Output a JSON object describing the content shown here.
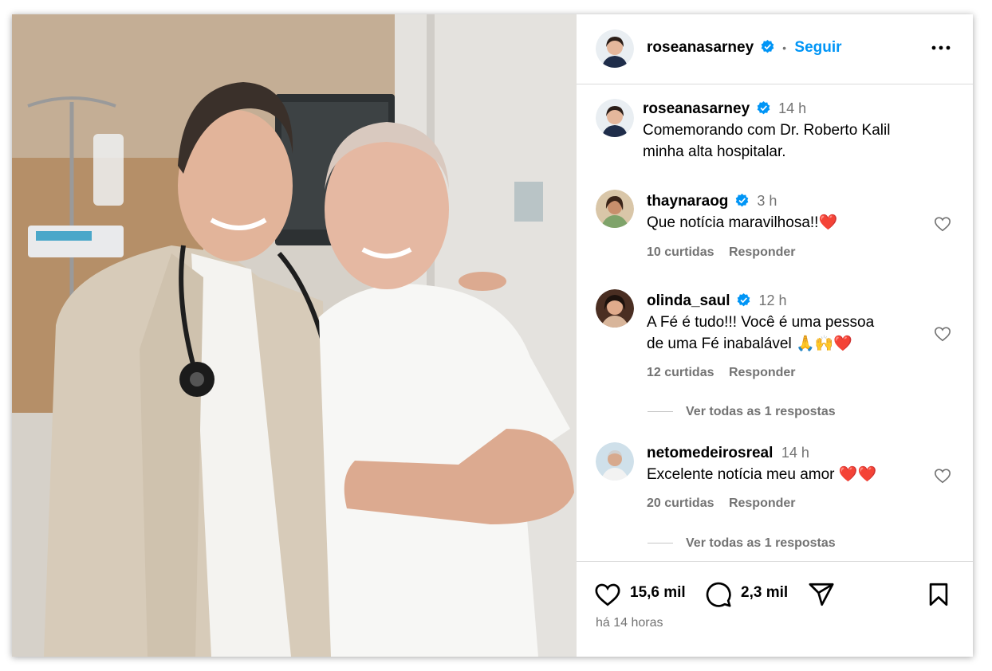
{
  "post": {
    "author": "roseanasarney",
    "follow_label": "Seguir",
    "separator": "•",
    "more_icon": "more-icon",
    "caption_time": "14 h",
    "caption_line1": "Comemorando com Dr. Roberto Kalil",
    "caption_line2": "minha alta hospitalar.",
    "likes": "15,6 mil",
    "comments_count": "2,3 mil",
    "posted_ago": "há 14 horas"
  },
  "comments": [
    {
      "user": "thaynaraog",
      "time": "3 h",
      "verified": true,
      "text_line1": "Que notícia maravilhosa!!❤️",
      "text_line2": "",
      "likes": "10 curtidas",
      "reply": "Responder"
    },
    {
      "user": "olinda_saul",
      "time": "12 h",
      "verified": true,
      "text_line1": "A Fé é tudo!!! Você é uma pessoa",
      "text_line2": "de uma Fé inabalável 🙏🙌❤️",
      "likes": "12 curtidas",
      "reply": "Responder",
      "view_replies": "Ver todas as 1 respostas"
    },
    {
      "user": "netomedeirosreal",
      "time": "14 h",
      "verified": false,
      "text_line1": "Excelente notícia meu amor ❤️❤️",
      "text_line2": "",
      "likes": "20 curtidas",
      "reply": "Responder",
      "view_replies": "Ver todas as 1 respostas"
    }
  ],
  "colors": {
    "link": "#0095f6",
    "verified": "#0095f6",
    "muted": "#737373",
    "divider": "#dbdbdb"
  }
}
